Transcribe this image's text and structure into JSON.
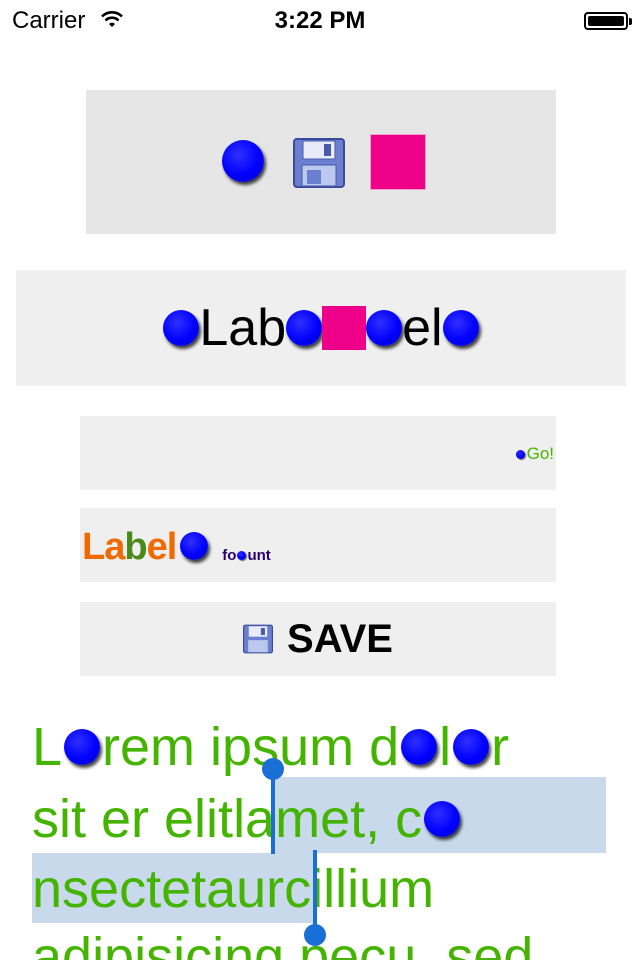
{
  "status_bar": {
    "carrier": "Carrier",
    "time": "3:22 PM",
    "icons": [
      "wifi-icon",
      "battery-icon"
    ]
  },
  "image_row": {
    "icons": [
      "blue-ball-icon",
      "floppy-disk-icon",
      "pink-square-icon"
    ]
  },
  "label_row": {
    "parts": [
      "Lab",
      "el"
    ],
    "icons": [
      "blue-ball-icon",
      "pink-square-icon"
    ]
  },
  "go_row": {
    "text": "Go!"
  },
  "attributed_row": {
    "big_text": [
      {
        "text": "L",
        "color": "#f06a00"
      },
      {
        "text": "a",
        "color": "#f06a00"
      },
      {
        "text": "b",
        "color": "#4a8a18"
      },
      {
        "text": "e",
        "color": "#f06a00"
      },
      {
        "text": "l",
        "color": "#f06a00"
      }
    ],
    "small_text": [
      "fo",
      "unt"
    ]
  },
  "save_button": {
    "label": "SAVE",
    "icon": "floppy-disk-icon"
  },
  "text_view": {
    "lines": [
      [
        "L",
        "rem ipsum d",
        "l",
        "r"
      ],
      [
        "sit er elit ",
        "lamet, c"
      ],
      [
        "nsectetaur",
        " cillium"
      ],
      [
        "adipisicing pecu, sed"
      ]
    ],
    "text_color": "#44b400",
    "selection_color": "#c8d9ec",
    "handle_color": "#1a6fd6"
  }
}
